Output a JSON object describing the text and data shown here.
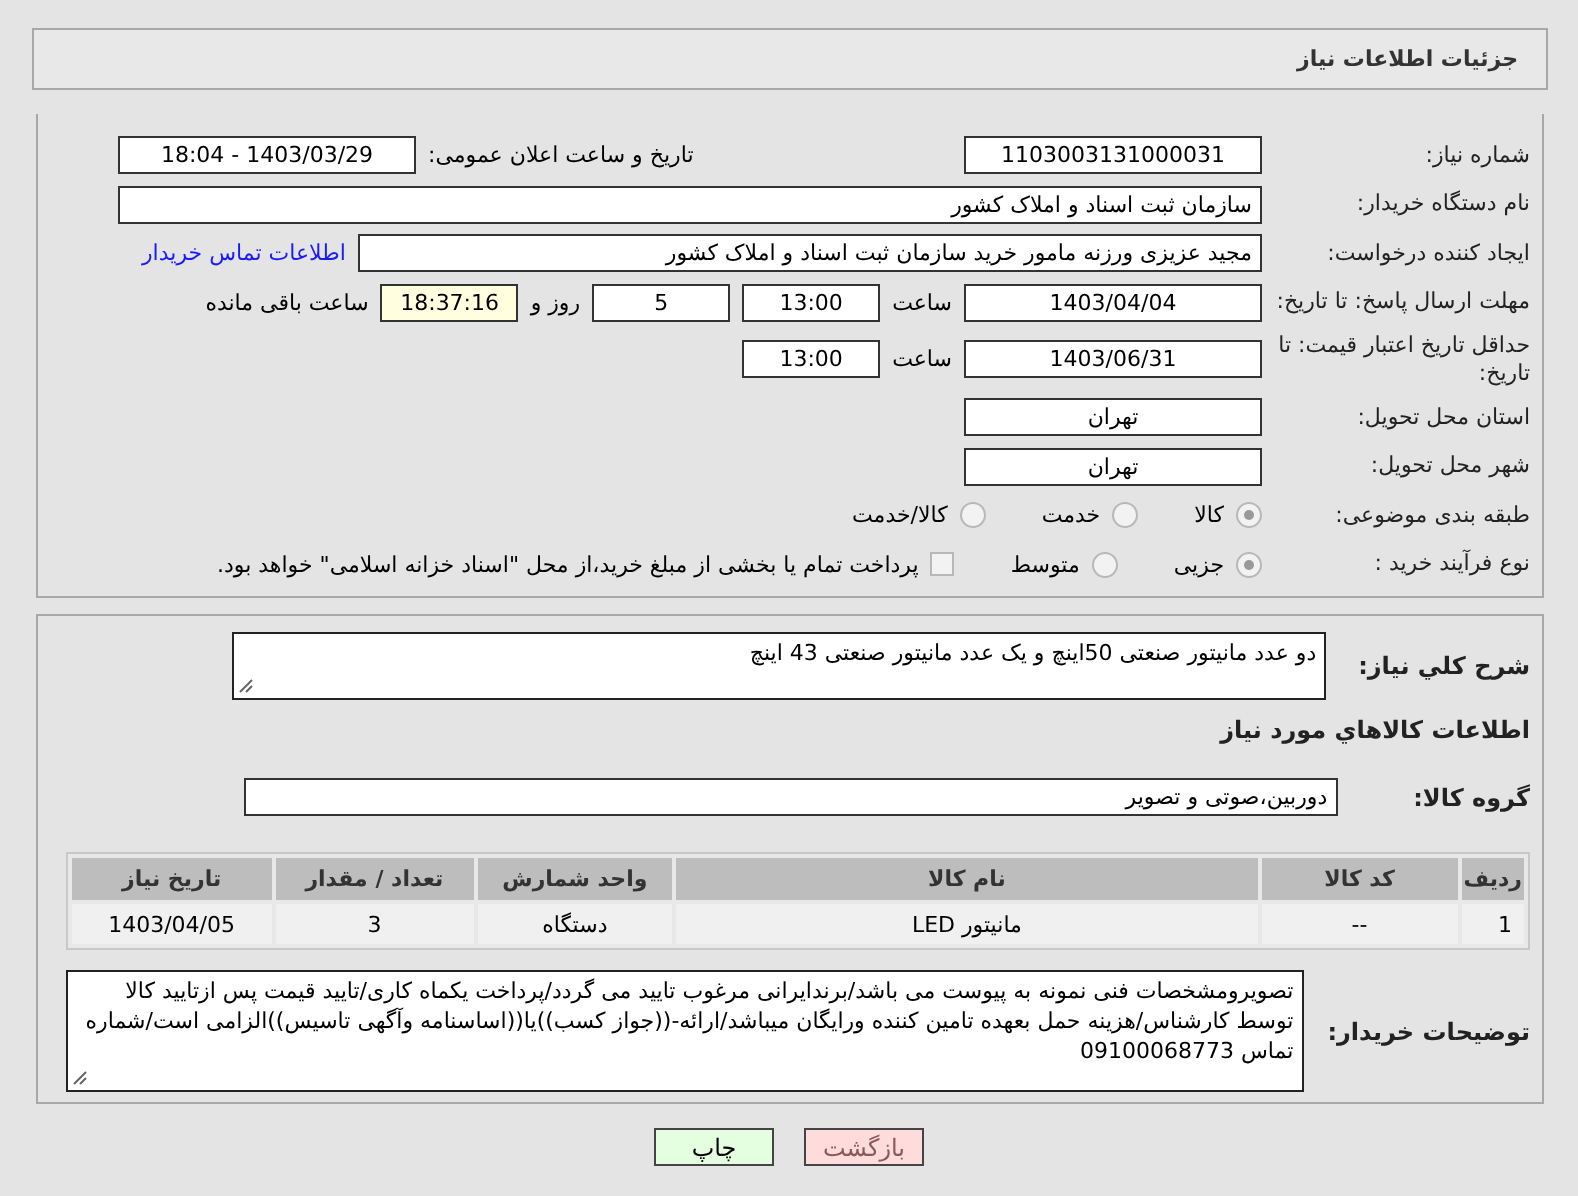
{
  "header": {
    "title": "جزئیات اطلاعات نیاز"
  },
  "details": {
    "rows": [
      {
        "label": "شماره نیاز:",
        "items": [
          {
            "kind": "field",
            "value": "1103003131000031"
          },
          {
            "kind": "push-text",
            "value": "تاریخ و ساعت اعلان عمومی:"
          },
          {
            "kind": "field",
            "value": "1403/03/29 - 18:04"
          }
        ]
      },
      {
        "label": "نام دستگاه خریدار:",
        "items": [
          {
            "kind": "wide-field",
            "value": "سازمان ثبت اسناد و املاک کشور"
          }
        ]
      },
      {
        "label": "ایجاد کننده درخواست:",
        "items": [
          {
            "kind": "wide-field",
            "value": "مجید عزیزی ورزنه مامور خرید سازمان ثبت اسناد و املاک کشور"
          },
          {
            "kind": "link",
            "value": "اطلاعات تماس خریدار"
          }
        ]
      },
      {
        "label": "مهلت ارسال پاسخ: تا تاریخ:",
        "items": [
          {
            "kind": "field",
            "value": "1403/04/04"
          },
          {
            "kind": "text",
            "value": "ساعت"
          },
          {
            "kind": "short-field",
            "value": "13:00",
            "highlighted": false
          },
          {
            "kind": "short-field",
            "value": "5",
            "highlighted": false
          },
          {
            "kind": "text",
            "value": "روز و"
          },
          {
            "kind": "short-field",
            "value": "18:37:16",
            "highlighted": true
          },
          {
            "kind": "text",
            "value": "ساعت باقی مانده"
          }
        ]
      },
      {
        "label": "حداقل تاریخ اعتبار قیمت: تا تاریخ:",
        "items": [
          {
            "kind": "field",
            "value": "1403/06/31"
          },
          {
            "kind": "text",
            "value": "ساعت"
          },
          {
            "kind": "short-field",
            "value": "13:00",
            "highlighted": false
          }
        ]
      },
      {
        "label": "استان محل تحویل:",
        "items": [
          {
            "kind": "field",
            "value": "تهران"
          }
        ]
      },
      {
        "label": "شهر محل تحویل:",
        "items": [
          {
            "kind": "field",
            "value": "تهران"
          }
        ]
      },
      {
        "label": "طبقه بندی موضوعی:",
        "items": [
          {
            "kind": "radio",
            "value": "کالا",
            "selected": true
          },
          {
            "kind": "radio",
            "value": "خدمت",
            "selected": false
          },
          {
            "kind": "radio",
            "value": "کالا/خدمت",
            "selected": false
          }
        ]
      },
      {
        "label": "نوع فرآیند خرید :",
        "items": [
          {
            "kind": "radio",
            "value": "جزیی",
            "selected": true
          },
          {
            "kind": "radio",
            "value": "متوسط",
            "selected": false
          },
          {
            "kind": "checkbox",
            "value": "پرداخت تمام یا بخشی از مبلغ خرید،از محل \"اسناد خزانه اسلامی\" خواهد بود.",
            "checked": false
          }
        ]
      }
    ]
  },
  "summary": {
    "label": "شرح کلي نياز:",
    "value": "دو عدد مانیتور صنعتی 50اینچ و یک عدد مانیتور صنعتی 43 اینچ"
  },
  "items_heading": "اطلاعات کالاهاي مورد نياز",
  "goods_group": {
    "label": "گروه کالا:",
    "value": "دوربین،صوتی و تصویر"
  },
  "table": {
    "columns": [
      "ردیف",
      "کد کالا",
      "نام کالا",
      "واحد شمارش",
      "تعداد / مقدار",
      "تاریخ نیاز"
    ],
    "rows": [
      [
        "1",
        "--",
        "مانیتور LED",
        "دستگاه",
        "3",
        "1403/04/05"
      ]
    ]
  },
  "buyer_notes": {
    "label": "توضیحات خریدار:",
    "value": "تصویرومشخصات فنی نمونه به پیوست می باشد/برندایرانی مرغوب تایید می گردد/پرداخت یکماه کاری/تایید قیمت پس ازتایید کالا توسط کارشناس/هزینه حمل بعهده تامین کننده ورایگان میباشد/ارائه-((جواز کسب))یا((اساسنامه وآگهی تاسیس))الزامی است/شماره تماس 09100068773"
  },
  "buttons": [
    {
      "kind": "back",
      "label": "بازگشت"
    },
    {
      "kind": "print",
      "label": "چاپ"
    }
  ]
}
